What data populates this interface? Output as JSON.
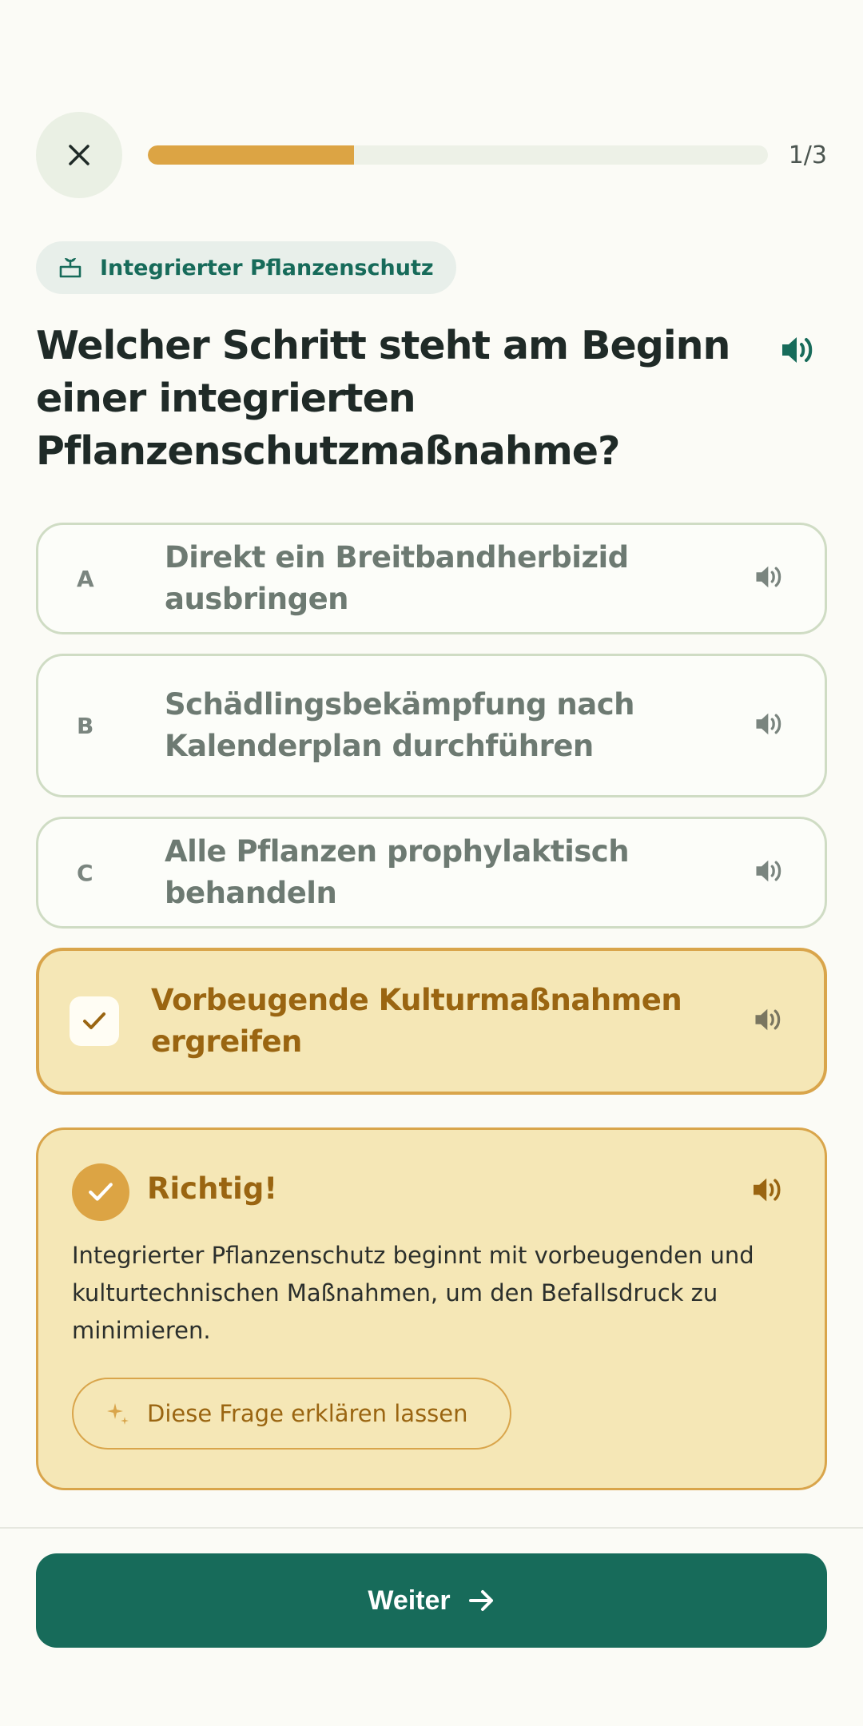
{
  "progress": {
    "value": 0.333,
    "label": "1/3"
  },
  "topic": {
    "label": "Integrierter Pflanzenschutz",
    "icon": "plant-sprout-icon"
  },
  "question": {
    "text": "Welcher Schritt steht am Beginn einer integrierten Pflanzenschutzmaßnahme?"
  },
  "options": [
    {
      "letter": "A",
      "text": "Direkt ein Breitbandherbizid ausbringen",
      "selected": false
    },
    {
      "letter": "B",
      "text": "Schädlingsbekämpfung nach Kalenderplan durchführen",
      "selected": false
    },
    {
      "letter": "C",
      "text": "Alle Pflanzen prophylaktisch behandeln",
      "selected": false
    },
    {
      "letter": "",
      "text": "Vorbeugende Kulturmaßnahmen ergreifen",
      "selected": true
    }
  ],
  "feedback": {
    "title": "Richtig!",
    "text": "Integrierter Pflanzenschutz beginnt mit vorbeugenden und kulturtechnischen Maßnahmen, um den Befallsdruck zu minimieren.",
    "explain_label": "Diese Frage erklären lassen"
  },
  "footer": {
    "next_label": "Weiter"
  },
  "colors": {
    "accent": "#dca444",
    "primary": "#176b5a",
    "selected_bg": "#f5e7b6",
    "option_border": "#cfdcc4"
  }
}
